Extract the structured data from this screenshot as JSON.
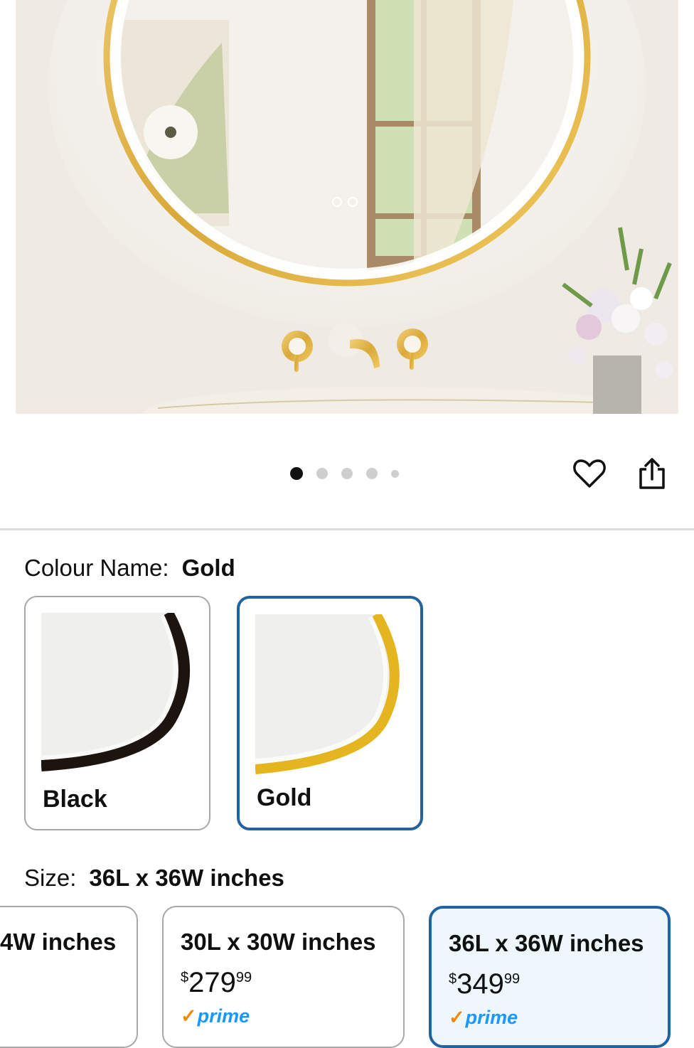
{
  "carousel": {
    "count": 5,
    "active_index": 0
  },
  "actions": {
    "favorite_icon": "heart-icon",
    "share_icon": "share-icon"
  },
  "colour": {
    "label": "Colour Name:",
    "selected": "Gold",
    "options": [
      {
        "name": "Black",
        "frame_color": "#1d1410"
      },
      {
        "name": "Gold",
        "frame_color": "#e5b51f"
      }
    ]
  },
  "size": {
    "label": "Size:",
    "selected": "36L x 36W inches",
    "options": [
      {
        "name": "4W inches"
      },
      {
        "name": "30L x 30W inches",
        "price_symbol": "$",
        "price_whole": "279",
        "price_fraction": "99",
        "badge": "prime"
      },
      {
        "name": "36L x 36W inches",
        "price_symbol": "$",
        "price_whole": "349",
        "price_fraction": "99",
        "badge": "prime"
      }
    ]
  },
  "colors": {
    "selection_border": "#2162a1",
    "prime_blue": "#1a98ff",
    "prime_check": "#f08804"
  }
}
